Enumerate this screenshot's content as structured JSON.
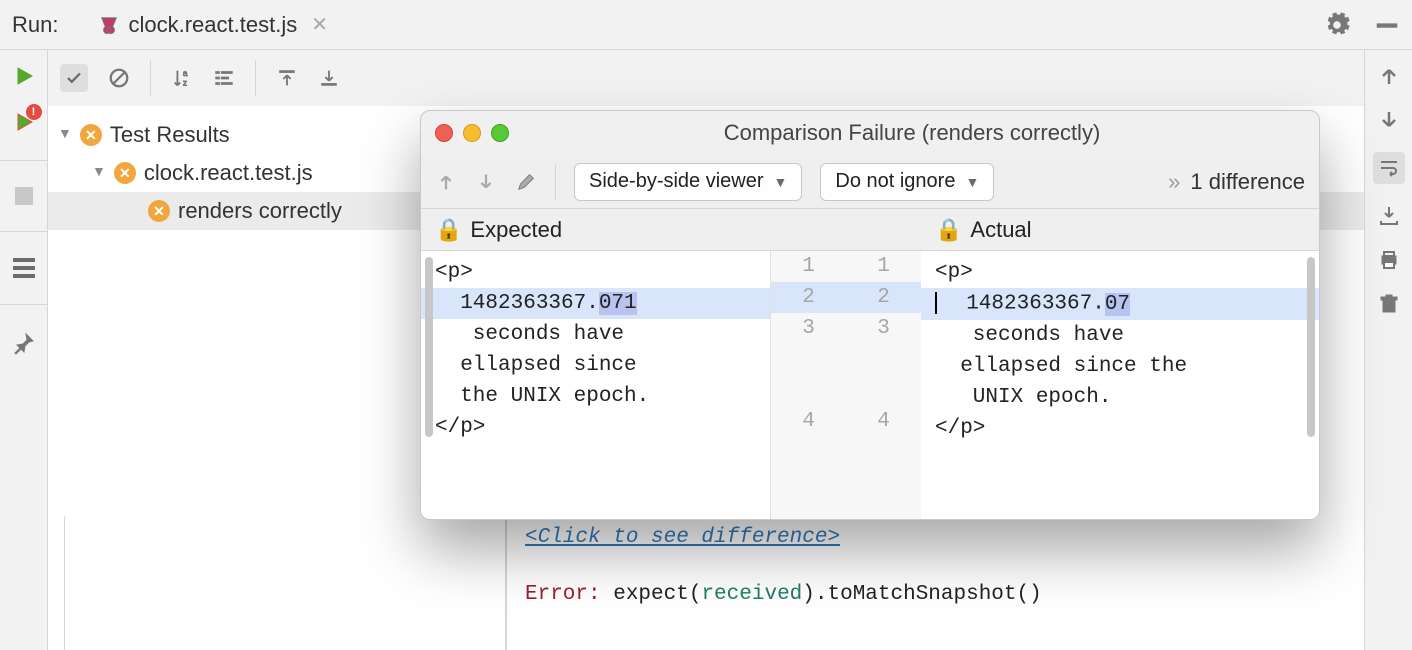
{
  "tabbar": {
    "label": "Run:",
    "filename": "clock.react.test.js"
  },
  "tree": {
    "root": "Test Results",
    "file": "clock.react.test.js",
    "test": "renders correctly"
  },
  "dialog": {
    "title": "Comparison Failure (renders correctly)",
    "viewer": "Side-by-side viewer",
    "ignore": "Do not ignore",
    "count": "1 difference",
    "expected_label": "Expected",
    "actual_label": "Actual",
    "expected_lines": {
      "l1": "<p>",
      "l2a": "  1482363367.",
      "l2b": "071",
      "l3": "   seconds have",
      "l3b": "  ellapsed since",
      "l3c": "  the UNIX epoch.",
      "l4": "</p>"
    },
    "actual_lines": {
      "l1": "<p>",
      "l2a": "  1482363367.",
      "l2b": "07",
      "l3": "   seconds have",
      "l3b": "  ellapsed since the",
      "l3c": "   UNIX epoch.",
      "l4": "</p>"
    },
    "nums": {
      "n1": "1",
      "n2": "2",
      "n3": "3",
      "n4": "4"
    }
  },
  "console": {
    "link": "<Click to see difference>",
    "error_label": "Error:",
    "txt1": " expect(",
    "rec": "received",
    "txt2": ").toMatchSnapshot()"
  }
}
